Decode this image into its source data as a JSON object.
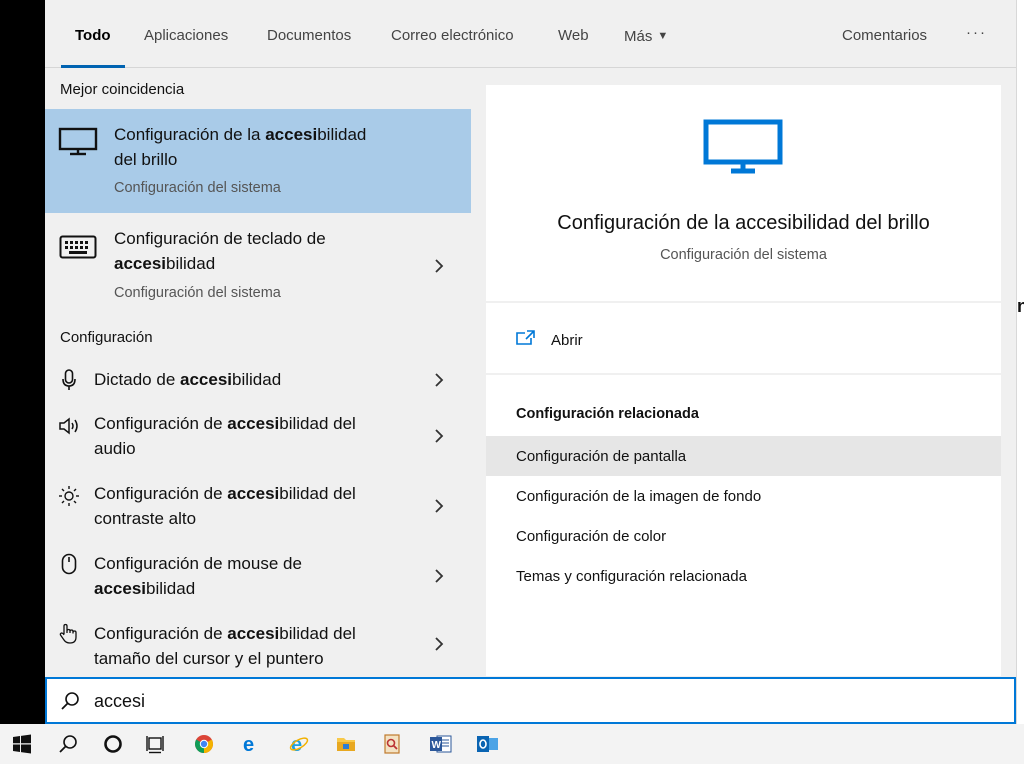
{
  "tabs": [
    {
      "label": "Todo"
    },
    {
      "label": "Aplicaciones"
    },
    {
      "label": "Documentos"
    },
    {
      "label": "Correo electrónico"
    },
    {
      "label": "Web"
    },
    {
      "label": "Más"
    }
  ],
  "feedback_label": "Comentarios",
  "more_options_label": "···",
  "best_match": {
    "header": "Mejor coincidencia",
    "item": {
      "title_prefix": "Configuración de la ",
      "title_bold": "accesi",
      "title_suffix": "bilidad",
      "title_line2": "del brillo",
      "subtitle": "Configuración del sistema",
      "icon": "monitor-icon"
    }
  },
  "keyboard_result": {
    "title_line1": "Configuración de teclado de",
    "title_bold": "accesi",
    "title_suffix": "bilidad",
    "subtitle": "Configuración del sistema",
    "icon": "keyboard-icon"
  },
  "settings_section": {
    "header": "Configuración",
    "items": [
      {
        "prefix": "Dictado de ",
        "bold": "accesi",
        "suffix": "bilidad",
        "line2": "",
        "icon": "microphone-icon"
      },
      {
        "prefix": "Configuración de ",
        "bold": "accesi",
        "suffix": "bilidad del",
        "line2": "audio",
        "icon": "speaker-icon"
      },
      {
        "prefix": "Configuración de ",
        "bold": "accesi",
        "suffix": "bilidad del",
        "line2": "contraste alto",
        "icon": "brightness-icon"
      },
      {
        "prefix": "Configuración de mouse de",
        "bold": "accesi",
        "suffix": "bilidad",
        "line2": "",
        "icon": "mouse-icon"
      },
      {
        "prefix": "Configuración de ",
        "bold": "accesi",
        "suffix": "bilidad del",
        "line2": "tamaño del cursor y el puntero",
        "icon": "hand-pointer-icon"
      }
    ]
  },
  "detail": {
    "title": "Configuración de la accesibilidad del brillo",
    "subtitle": "Configuración del sistema",
    "open_label": "Abrir",
    "related_header": "Configuración relacionada",
    "related": [
      "Configuración de pantalla",
      "Configuración de la imagen de fondo",
      "Configuración de color",
      "Temas y configuración relacionada"
    ],
    "accent_color": "#0078d7"
  },
  "search": {
    "value": "accesi"
  },
  "background_window": {
    "partial_text": "n"
  },
  "taskbar": {
    "icons": [
      "windows-start-icon",
      "search-icon",
      "cortana-icon",
      "task-view-icon",
      "chrome-icon",
      "edge-icon",
      "internet-explorer-icon",
      "file-explorer-icon",
      "photos-icon",
      "word-icon",
      "outlook-icon"
    ]
  }
}
